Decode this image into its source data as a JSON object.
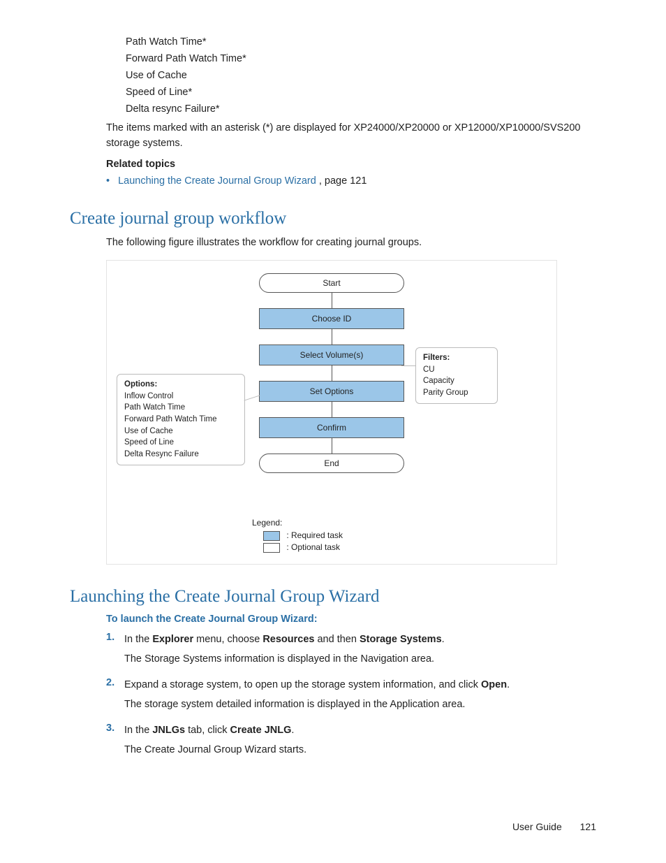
{
  "top_list": {
    "items": [
      "Path Watch Time*",
      "Forward Path Watch Time*",
      "Use of Cache",
      "Speed of Line*",
      "Delta resync Failure*"
    ]
  },
  "asterisk_note": "The items marked with an asterisk (*) are displayed for XP24000/XP20000 or XP12000/XP10000/SVS200 storage systems.",
  "related": {
    "heading": "Related topics",
    "bullet": "•",
    "link_text": "Launching the Create Journal Group Wizard",
    "rest": ", page 121"
  },
  "section1": {
    "title": "Create journal group workflow",
    "intro": "The following figure illustrates the workflow for creating journal groups."
  },
  "flow": {
    "start": "Start",
    "steps": [
      "Choose ID",
      "Select Volume(s)",
      "Set Options",
      "Confirm"
    ],
    "end": "End",
    "options_title": "Options:",
    "options": [
      "Inflow Control",
      "Path Watch Time",
      "Forward Path Watch Time",
      "Use of Cache",
      "Speed of Line",
      "Delta Resync Failure"
    ],
    "filters_title": "Filters:",
    "filters": [
      "CU",
      "Capacity",
      "Parity Group"
    ],
    "legend_title": "Legend:",
    "legend_req": ": Required task",
    "legend_opt": ": Optional task"
  },
  "section2": {
    "title": "Launching the Create Journal Group Wizard",
    "subhead": "To launch the Create Journal Group Wizard:",
    "steps": [
      {
        "num": "1.",
        "pre": "In the ",
        "b1": "Explorer",
        "mid1": " menu, choose ",
        "b2": "Resources",
        "mid2": " and then ",
        "b3": "Storage Systems",
        "post": ".",
        "sub": "The Storage Systems information is displayed in the Navigation area."
      },
      {
        "num": "2.",
        "pre": "Expand a storage system, to open up the storage system information, and click ",
        "b1": "Open",
        "post": ".",
        "sub": "The storage system detailed information is displayed in the Application area."
      },
      {
        "num": "3.",
        "pre": "In the ",
        "b1": "JNLGs",
        "mid1": " tab, click ",
        "b2": "Create JNLG",
        "post": ".",
        "sub": "The Create Journal Group Wizard starts."
      }
    ]
  },
  "footer": {
    "label": "User Guide",
    "page": "121"
  }
}
